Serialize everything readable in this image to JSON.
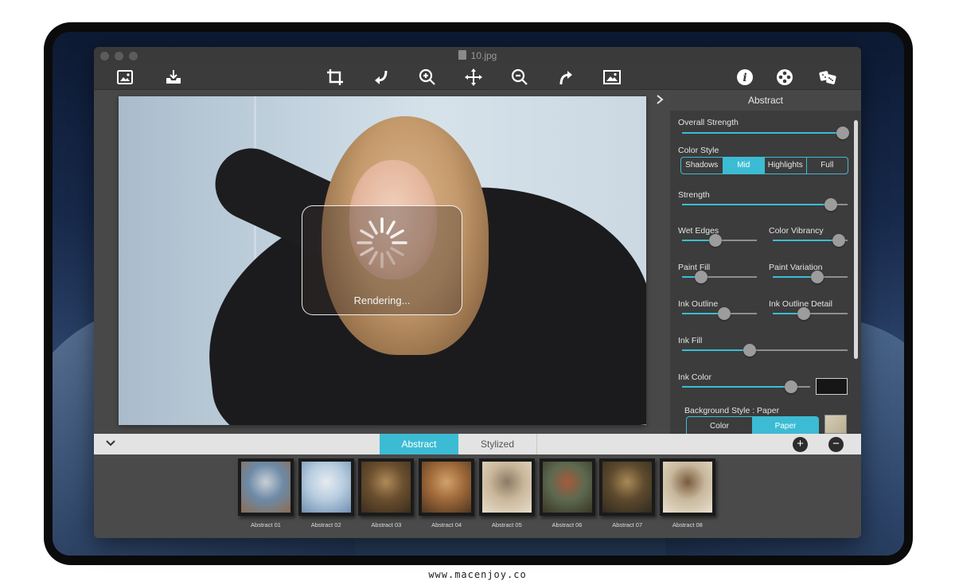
{
  "window": {
    "title": "10.jpg"
  },
  "toolbar": {
    "left_icons": [
      "image-icon",
      "import-tray-icon"
    ],
    "center_icons": [
      "crop-icon",
      "undo-arrow-icon",
      "zoom-in-icon",
      "move-arrows-icon",
      "zoom-out-icon",
      "redo-arrow-icon",
      "picture-icon"
    ],
    "right_icons": [
      "info-icon",
      "film-reel-icon",
      "dice-icon"
    ]
  },
  "canvas": {
    "rendering_text": "Rendering..."
  },
  "panel": {
    "header": "Abstract",
    "overall_strength": {
      "label": "Overall Strength",
      "value": 0.97
    },
    "color_style": {
      "label": "Color Style",
      "options": [
        "Shadows",
        "Mid",
        "Highlights",
        "Full"
      ],
      "selected": "Mid"
    },
    "strength": {
      "label": "Strength",
      "value": 0.9
    },
    "wet_edges": {
      "label": "Wet Edges",
      "value": 0.45
    },
    "color_vibrancy": {
      "label": "Color Vibrancy",
      "value": 0.88
    },
    "paint_fill": {
      "label": "Paint Fill",
      "value": 0.26
    },
    "paint_variation": {
      "label": "Paint Variation",
      "value": 0.6
    },
    "ink_outline": {
      "label": "Ink Outline",
      "value": 0.56
    },
    "ink_outline_detail": {
      "label": "Ink Outline Detail",
      "value": 0.42
    },
    "ink_fill": {
      "label": "Ink Fill",
      "value": 0.41
    },
    "ink_color": {
      "label": "Ink Color",
      "value": 0.85,
      "swatch": "#161616"
    },
    "background_style": {
      "label": "Background Style : Paper",
      "options": [
        "Color",
        "Paper"
      ],
      "selected": "Paper"
    },
    "accent": "#3cbcd4"
  },
  "tabs": {
    "items": [
      "Abstract",
      "Stylized"
    ],
    "selected": "Abstract"
  },
  "actions": {
    "add": "+",
    "remove": "−"
  },
  "thumbnails": [
    {
      "label": "Abstract 01",
      "colors": [
        "#6d8aa7",
        "#c9cfd6",
        "#8a6e52"
      ]
    },
    {
      "label": "Abstract 02",
      "colors": [
        "#b8cde0",
        "#e6ebef",
        "#6f8fb0"
      ]
    },
    {
      "label": "Abstract 03",
      "colors": [
        "#6b4f2f",
        "#b08a5a",
        "#3c2d1d"
      ]
    },
    {
      "label": "Abstract 04",
      "colors": [
        "#a06a3a",
        "#d0a26c",
        "#4f3620"
      ]
    },
    {
      "label": "Abstract 05",
      "colors": [
        "#cbb79a",
        "#8b7a66",
        "#e6dccb"
      ]
    },
    {
      "label": "Abstract 06",
      "colors": [
        "#5d6a50",
        "#a65a3c",
        "#3a3628"
      ]
    },
    {
      "label": "Abstract 07",
      "colors": [
        "#5e4a2e",
        "#a98a56",
        "#2f2a1f"
      ]
    },
    {
      "label": "Abstract 08",
      "colors": [
        "#c8b89c",
        "#7a5a3e",
        "#e8dfcf"
      ]
    }
  ],
  "footer": {
    "url": "www.macenjoy.co"
  }
}
